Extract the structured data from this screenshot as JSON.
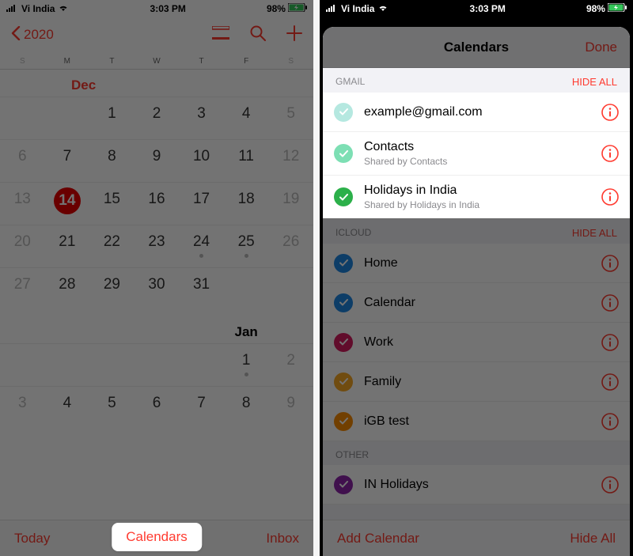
{
  "status": {
    "carrier": "Vi India",
    "time": "3:03 PM",
    "battery": "98%"
  },
  "leftPhone": {
    "backYear": "2020",
    "weekdays": [
      "S",
      "M",
      "T",
      "W",
      "T",
      "F",
      "S"
    ],
    "month1": "Dec",
    "month2": "Jan",
    "rows": [
      [
        "",
        "",
        "1",
        "2",
        "3",
        "4",
        "5"
      ],
      [
        "6",
        "7",
        "8",
        "9",
        "10",
        "11",
        "12"
      ],
      [
        "13",
        "14",
        "15",
        "16",
        "17",
        "18",
        "19"
      ],
      [
        "20",
        "21",
        "22",
        "23",
        "24",
        "25",
        "26"
      ],
      [
        "27",
        "28",
        "29",
        "30",
        "31",
        "",
        ""
      ]
    ],
    "janRows": [
      [
        "",
        "",
        "",
        "",
        "",
        "1",
        "2"
      ],
      [
        "3",
        "4",
        "5",
        "6",
        "7",
        "8",
        "9"
      ]
    ],
    "today": "14",
    "dotDays": [
      "24",
      "25"
    ],
    "janDotDays": [
      "1"
    ],
    "toolbar": {
      "today": "Today",
      "calendars": "Calendars",
      "inbox": "Inbox"
    }
  },
  "rightPhone": {
    "sheetTitle": "Calendars",
    "done": "Done",
    "sections": [
      {
        "name": "GMAIL",
        "hide": "HIDE ALL",
        "highlighted": true,
        "rows": [
          {
            "label": "example@gmail.com",
            "sub": "",
            "color": "#b5e8e0"
          },
          {
            "label": "Contacts",
            "sub": "Shared by Contacts",
            "color": "#7ddfb4"
          },
          {
            "label": "Holidays in India",
            "sub": "Shared by Holidays in India",
            "color": "#2cb04a"
          }
        ]
      },
      {
        "name": "ICLOUD",
        "hide": "HIDE ALL",
        "highlighted": false,
        "rows": [
          {
            "label": "Home",
            "sub": "",
            "color": "#1e88e5"
          },
          {
            "label": "Calendar",
            "sub": "",
            "color": "#1e88e5"
          },
          {
            "label": "Work",
            "sub": "",
            "color": "#d81b60"
          },
          {
            "label": "Family",
            "sub": "",
            "color": "#f9a825"
          },
          {
            "label": "iGB test",
            "sub": "",
            "color": "#fb8c00"
          }
        ]
      },
      {
        "name": "OTHER",
        "hide": "",
        "highlighted": false,
        "rows": [
          {
            "label": "IN Holidays",
            "sub": "",
            "color": "#8e24aa"
          }
        ]
      }
    ],
    "toolbar": {
      "add": "Add Calendar",
      "hideAll": "Hide All"
    }
  },
  "colors": {
    "iosRed": "#ff3b30"
  }
}
